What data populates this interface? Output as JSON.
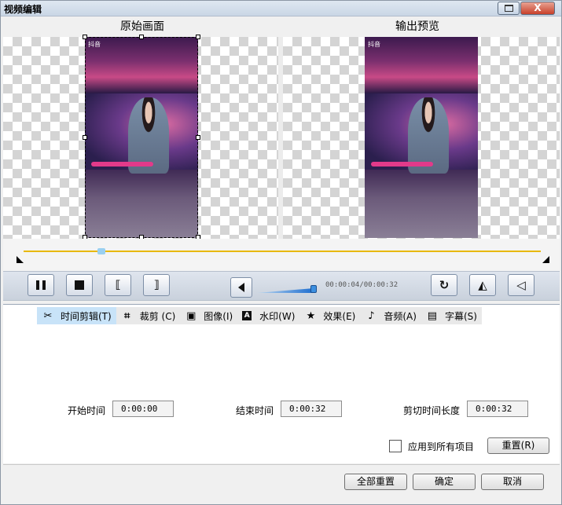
{
  "window": {
    "title": "视频编辑",
    "close_label": "X"
  },
  "preview": {
    "original_title": "原始画面",
    "output_title": "输出预览",
    "video_tag": "抖音"
  },
  "controls": {
    "timecode": "00:00:04/00:00:32",
    "volume_level": 0.95,
    "playhead_fraction": 0.15
  },
  "tabs": [
    {
      "label": "时间剪辑(T)",
      "icon": "scissors-icon",
      "active": true
    },
    {
      "label": "裁剪 (C)",
      "icon": "crop-icon",
      "active": false
    },
    {
      "label": "图像(I)",
      "icon": "image-icon",
      "active": false
    },
    {
      "label": "水印(W)",
      "icon": "watermark-icon",
      "active": false
    },
    {
      "label": "效果(E)",
      "icon": "star-icon",
      "active": false
    },
    {
      "label": "音频(A)",
      "icon": "music-note-icon",
      "active": false
    },
    {
      "label": "字幕(S)",
      "icon": "subtitle-icon",
      "active": false
    }
  ],
  "trim": {
    "start_label": "开始时间",
    "start_value": "0:00:00",
    "end_label": "结束时间",
    "end_value": "0:00:32",
    "length_label": "剪切时间长度",
    "length_value": "0:00:32"
  },
  "apply_all": {
    "label": "应用到所有项目",
    "checked": false
  },
  "reset_label": "重置(R)",
  "footer": {
    "reset_all": "全部重置",
    "ok": "确定",
    "cancel": "取消"
  }
}
